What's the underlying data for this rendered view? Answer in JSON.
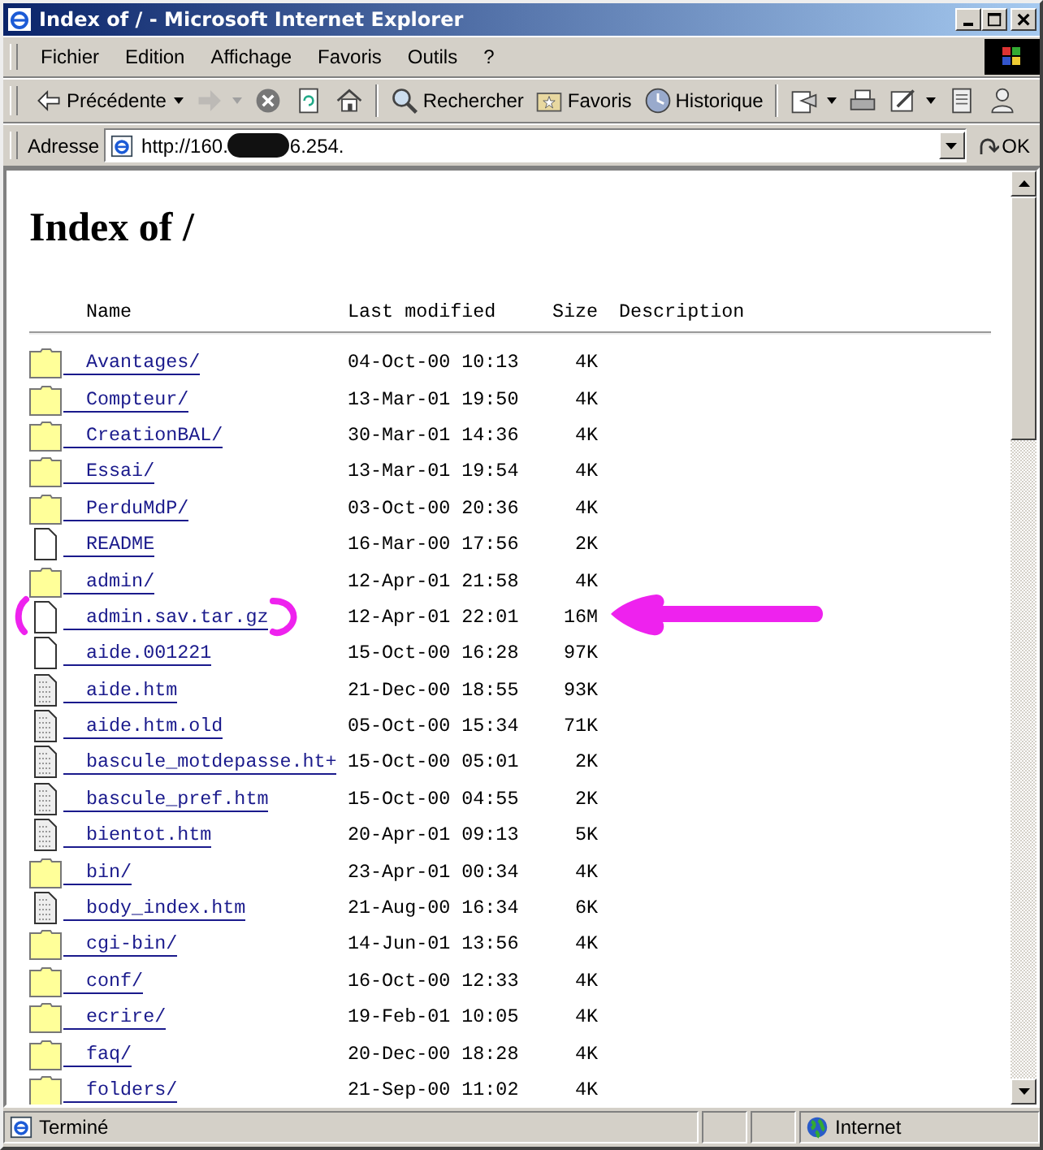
{
  "window": {
    "title": "Index of / - Microsoft Internet Explorer"
  },
  "menu": [
    {
      "label": "Fichier"
    },
    {
      "label": "Edition"
    },
    {
      "label": "Affichage"
    },
    {
      "label": "Favoris"
    },
    {
      "label": "Outils"
    },
    {
      "label": "?"
    }
  ],
  "toolbar": [
    {
      "kind": "back",
      "label": "Précédente",
      "disabled": false
    },
    {
      "kind": "forward",
      "disabled": true
    },
    {
      "kind": "stop",
      "disabled": false
    },
    {
      "kind": "refresh",
      "disabled": false
    },
    {
      "kind": "home",
      "disabled": false
    },
    {
      "kind": "separator"
    },
    {
      "kind": "search",
      "label": "Rechercher",
      "disabled": false
    },
    {
      "kind": "favorites",
      "label": "Favoris",
      "disabled": false
    },
    {
      "kind": "history",
      "label": "Historique",
      "disabled": false
    },
    {
      "kind": "separator"
    },
    {
      "kind": "mail",
      "disabled": false
    },
    {
      "kind": "print",
      "disabled": false
    },
    {
      "kind": "edit",
      "disabled": false
    },
    {
      "kind": "discuss",
      "disabled": false
    },
    {
      "kind": "messenger",
      "disabled": false
    }
  ],
  "address": {
    "label": "Adresse",
    "value_start": "http://160.",
    "value_end": "6.254.",
    "go": "OK"
  },
  "page": {
    "heading": "Index of /",
    "columns": [
      "Name",
      "Last modified",
      "Size",
      "Description"
    ],
    "rows": [
      {
        "kind": "folder",
        "name": "Avantages/",
        "modified": "04-Oct-00 10:13",
        "size": "4K",
        "annotated": false
      },
      {
        "kind": "folder",
        "name": "Compteur/",
        "modified": "13-Mar-01 19:50",
        "size": "4K",
        "annotated": false
      },
      {
        "kind": "folder",
        "name": "CreationBAL/",
        "modified": "30-Mar-01 14:36",
        "size": "4K",
        "annotated": false
      },
      {
        "kind": "folder",
        "name": "Essai/",
        "modified": "13-Mar-01 19:54",
        "size": "4K",
        "annotated": false
      },
      {
        "kind": "folder",
        "name": "PerduMdP/",
        "modified": "03-Oct-00 20:36",
        "size": "4K",
        "annotated": false
      },
      {
        "kind": "file",
        "name": "README",
        "modified": "16-Mar-00 17:56",
        "size": "2K",
        "annotated": false
      },
      {
        "kind": "folder",
        "name": "admin/",
        "modified": "12-Apr-01 21:58",
        "size": "4K",
        "annotated": false
      },
      {
        "kind": "file",
        "name": "admin.sav.tar.gz",
        "modified": "12-Apr-01 22:01",
        "size": "16M",
        "annotated": true
      },
      {
        "kind": "file",
        "name": "aide.001221",
        "modified": "15-Oct-00 16:28",
        "size": "97K",
        "annotated": false
      },
      {
        "kind": "text",
        "name": "aide.htm",
        "modified": "21-Dec-00 18:55",
        "size": "93K",
        "annotated": false
      },
      {
        "kind": "text",
        "name": "aide.htm.old",
        "modified": "05-Oct-00 15:34",
        "size": "71K",
        "annotated": false
      },
      {
        "kind": "text",
        "name": "bascule_motdepasse.ht+",
        "modified": "15-Oct-00 05:01",
        "size": "2K",
        "annotated": false
      },
      {
        "kind": "text",
        "name": "bascule_pref.htm",
        "modified": "15-Oct-00 04:55",
        "size": "2K",
        "annotated": false
      },
      {
        "kind": "text",
        "name": "bientot.htm",
        "modified": "20-Apr-01 09:13",
        "size": "5K",
        "annotated": false
      },
      {
        "kind": "folder",
        "name": "bin/",
        "modified": "23-Apr-01 00:34",
        "size": "4K",
        "annotated": false
      },
      {
        "kind": "text",
        "name": "body_index.htm",
        "modified": "21-Aug-00 16:34",
        "size": "6K",
        "annotated": false
      },
      {
        "kind": "folder",
        "name": "cgi-bin/",
        "modified": "14-Jun-01 13:56",
        "size": "4K",
        "annotated": false
      },
      {
        "kind": "folder",
        "name": "conf/",
        "modified": "16-Oct-00 12:33",
        "size": "4K",
        "annotated": false
      },
      {
        "kind": "folder",
        "name": "ecrire/",
        "modified": "19-Feb-01 10:05",
        "size": "4K",
        "annotated": false
      },
      {
        "kind": "folder",
        "name": "faq/",
        "modified": "20-Dec-00 18:28",
        "size": "4K",
        "annotated": false
      },
      {
        "kind": "folder",
        "name": "folders/",
        "modified": "21-Sep-00 11:02",
        "size": "4K",
        "annotated": false
      }
    ]
  },
  "status_bar": {
    "text": "Terminé",
    "zone": "Internet"
  }
}
